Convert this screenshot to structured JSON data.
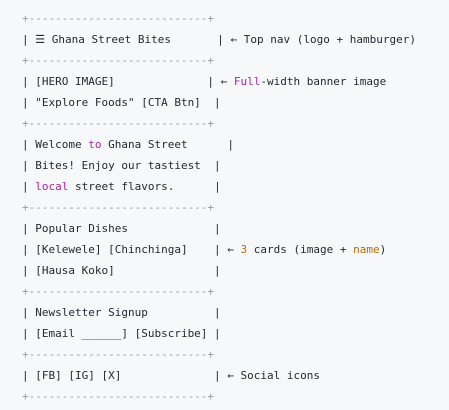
{
  "lines": [
    {
      "kind": "border",
      "text": "+---------------------------+"
    },
    {
      "kind": "text",
      "segments": [
        {
          "t": "| ☰ Ghana Street Bites       | ← Top nav (logo + hamburger)",
          "c": ""
        }
      ]
    },
    {
      "kind": "border",
      "text": "+---------------------------+"
    },
    {
      "kind": "text",
      "segments": [
        {
          "t": "| [HERO IMAGE]              | ← ",
          "c": ""
        },
        {
          "t": "Full",
          "c": "purple"
        },
        {
          "t": "-width banner image",
          "c": ""
        }
      ]
    },
    {
      "kind": "text",
      "segments": [
        {
          "t": "| \"Explore Foods\" [CTA Btn]  |",
          "c": ""
        }
      ]
    },
    {
      "kind": "border",
      "text": "+---------------------------+"
    },
    {
      "kind": "text",
      "segments": [
        {
          "t": "| Welcome ",
          "c": ""
        },
        {
          "t": "to",
          "c": "purple"
        },
        {
          "t": " Ghana Street      |",
          "c": ""
        }
      ]
    },
    {
      "kind": "text",
      "segments": [
        {
          "t": "| Bites! Enjoy our tastiest  |",
          "c": ""
        }
      ]
    },
    {
      "kind": "text",
      "segments": [
        {
          "t": "| ",
          "c": ""
        },
        {
          "t": "local",
          "c": "purple"
        },
        {
          "t": " street flavors.      |",
          "c": ""
        }
      ]
    },
    {
      "kind": "border",
      "text": "+---------------------------+"
    },
    {
      "kind": "text",
      "segments": [
        {
          "t": "| Popular Dishes             |",
          "c": ""
        }
      ]
    },
    {
      "kind": "text",
      "segments": [
        {
          "t": "| [Kelewele] [Chinchinga]    | ← ",
          "c": ""
        },
        {
          "t": "3",
          "c": "orange"
        },
        {
          "t": " cards (image + ",
          "c": ""
        },
        {
          "t": "name",
          "c": "orange"
        },
        {
          "t": ")",
          "c": ""
        }
      ]
    },
    {
      "kind": "text",
      "segments": [
        {
          "t": "| [Hausa Koko]               |",
          "c": ""
        }
      ]
    },
    {
      "kind": "border",
      "text": "+---------------------------+"
    },
    {
      "kind": "text",
      "segments": [
        {
          "t": "| Newsletter Signup          |",
          "c": ""
        }
      ]
    },
    {
      "kind": "text",
      "segments": [
        {
          "t": "| [Email ______] [Subscribe] |",
          "c": ""
        }
      ]
    },
    {
      "kind": "border",
      "text": "+---------------------------+"
    },
    {
      "kind": "text",
      "segments": [
        {
          "t": "| [FB] [IG] [X]              | ← Social icons",
          "c": ""
        }
      ]
    },
    {
      "kind": "border",
      "text": "+---------------------------+"
    }
  ]
}
